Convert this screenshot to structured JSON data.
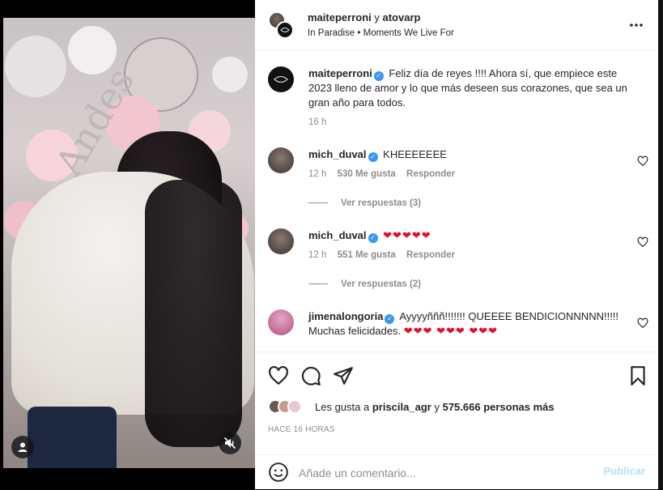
{
  "header": {
    "user1": "maiteperroni",
    "conjunction": "y",
    "user2": "atovarp",
    "location": "In Paradise",
    "separator": "•",
    "audio": "Moments We Live For",
    "more_icon": "more-horizontal-icon"
  },
  "caption": {
    "username": "maiteperroni",
    "text": "Feliz día de reyes !!!! Ahora sí, que empiece este 2023 lleno de amor y lo que más deseen sus corazones, que sea un gran año para todos.",
    "time": "16 h"
  },
  "comments": [
    {
      "username": "mich_duval",
      "text": "KHEEEEEEE",
      "time": "12 h",
      "likes": "530 Me gusta",
      "reply": "Responder",
      "view_replies": "Ver respuestas (3)"
    },
    {
      "username": "mich_duval",
      "text": "❤❤❤❤❤",
      "time": "12 h",
      "likes": "551 Me gusta",
      "reply": "Responder",
      "view_replies": "Ver respuestas (2)"
    },
    {
      "username": "jimenalongoria",
      "text": "Ayyyyñññ!!!!!!! QUEEEE BENDICIONNNNN!!!!! Muchas felicidades.",
      "hearts": "❤❤❤ ❤❤❤ ❤❤❤"
    }
  ],
  "likes": {
    "prefix": "Les gusta a",
    "user": "priscila_agr",
    "middle": "y",
    "count": "575.666 personas más"
  },
  "time_ago": "HACE 16 HORAS",
  "add_comment": {
    "placeholder": "Añade un comentario...",
    "post_label": "Publicar"
  },
  "colors": {
    "verified": "#3897f0",
    "heart": "#e0122a",
    "post_disabled": "#b2dffc"
  }
}
